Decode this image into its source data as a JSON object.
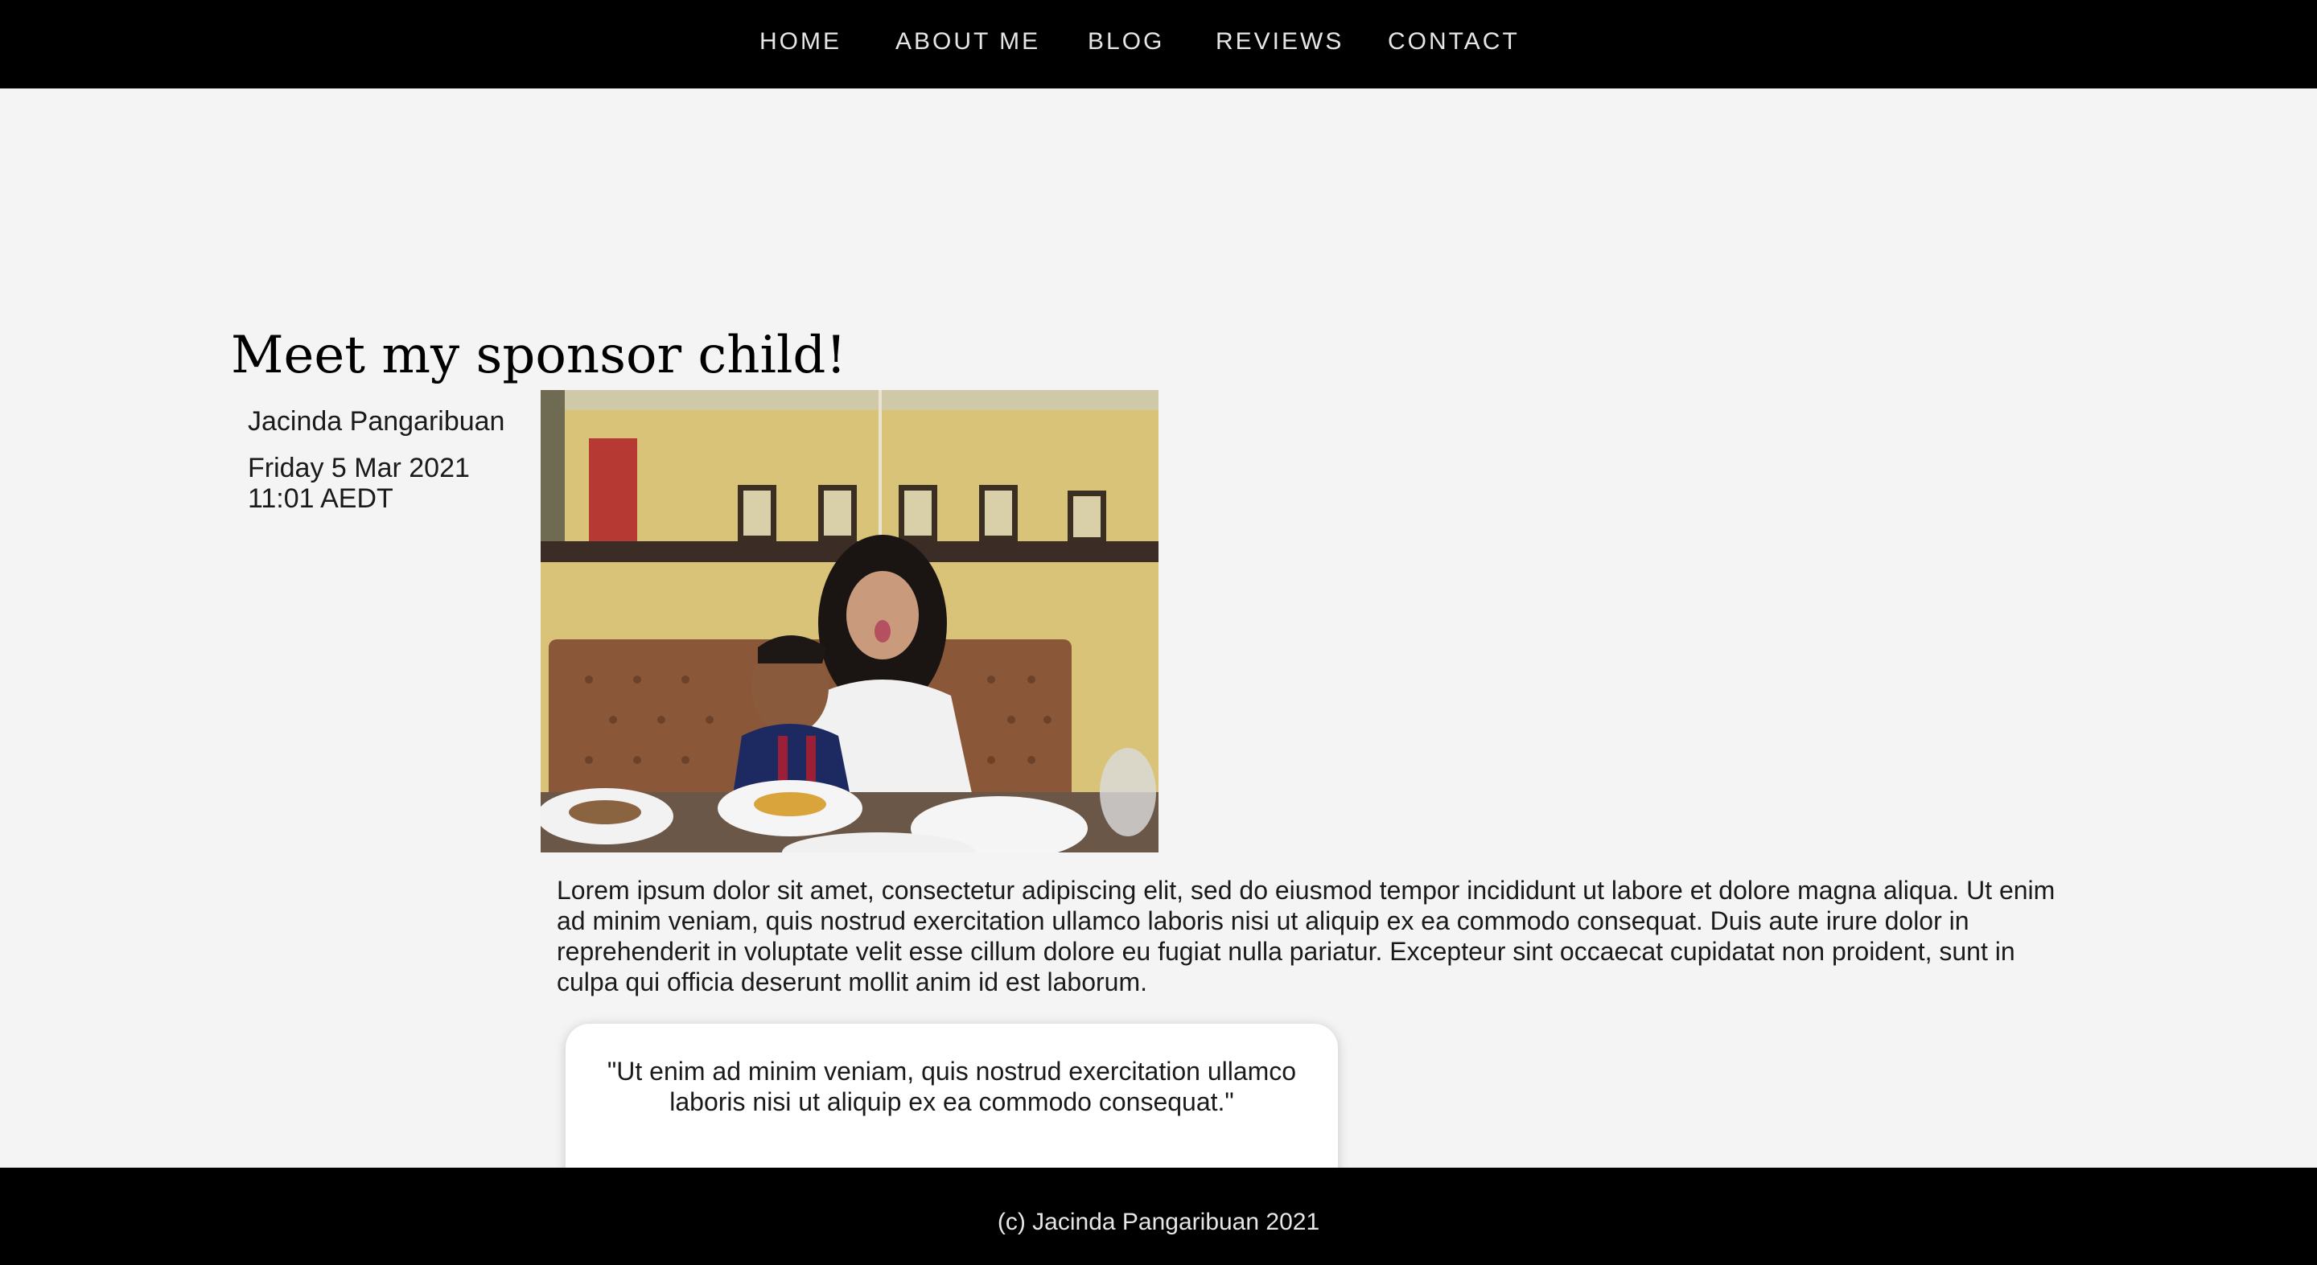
{
  "nav": {
    "items": [
      {
        "label": "HOME"
      },
      {
        "label": "ABOUT ME"
      },
      {
        "label": "BLOG"
      },
      {
        "label": "REVIEWS"
      },
      {
        "label": "CONTACT"
      }
    ]
  },
  "post": {
    "title": "Meet my sponsor child!",
    "author": "Jacinda Pangaribuan",
    "date": "Friday 5 Mar 2021 11:01 AEDT",
    "body": "Lorem ipsum dolor sit amet, consectetur adipiscing elit, sed do eiusmod tempor incididunt ut labore et dolore magna aliqua. Ut enim ad minim veniam, quis nostrud exercitation ullamco laboris nisi ut aliquip ex ea commodo consequat. Duis aute irure dolor in reprehenderit in voluptate velit esse cillum dolore eu fugiat nulla pariatur. Excepteur sint occaecat cupidatat non proident, sunt in culpa qui officia deserunt mollit anim id est laborum.",
    "quote": "\"Ut enim ad minim veniam, quis nostrud exercitation ullamco laboris nisi ut aliquip ex ea commodo consequat.\""
  },
  "footer": {
    "text": "(c) Jacinda Pangaribuan 2021"
  },
  "colors": {
    "nav_background": "#000000",
    "page_background": "#f4f4f4",
    "nav_text": "#e6e6e6",
    "card_background": "#ffffff"
  }
}
